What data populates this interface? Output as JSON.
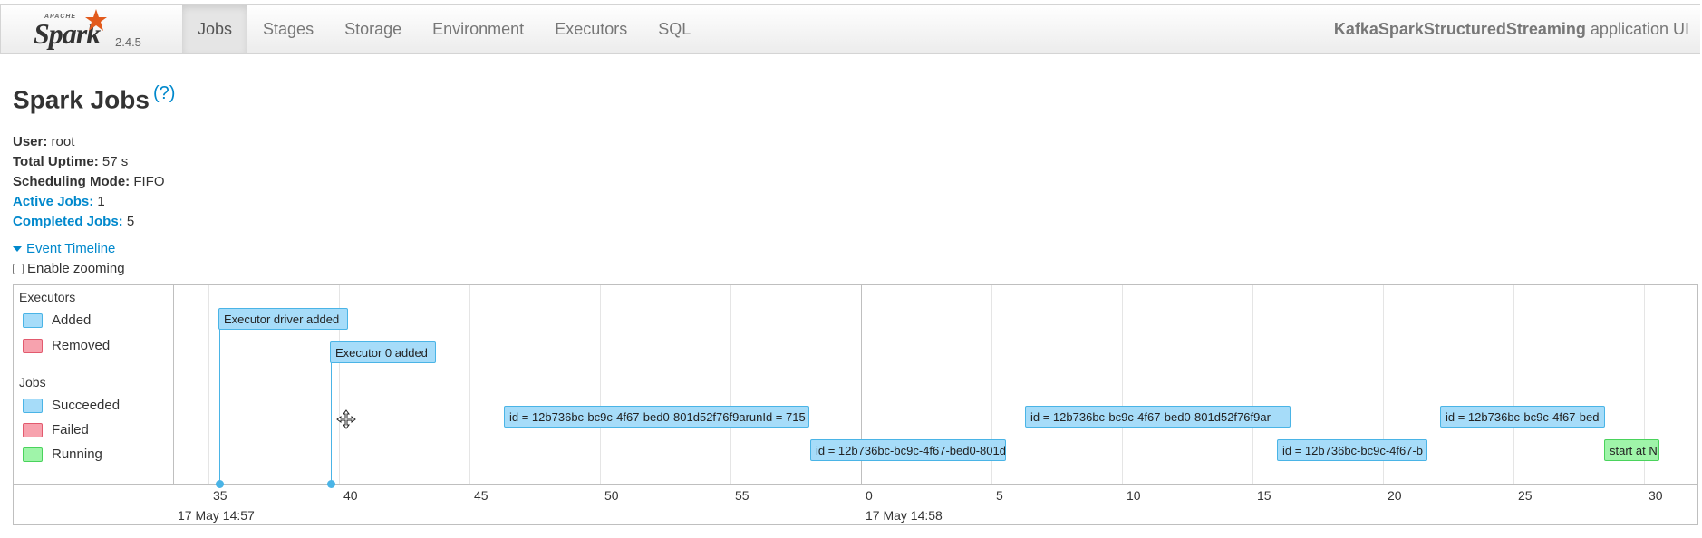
{
  "navbar": {
    "brand_apache": "APACHE",
    "brand_spark": "Spark",
    "version": "2.4.5",
    "tabs": [
      {
        "label": "Jobs",
        "active": true
      },
      {
        "label": "Stages",
        "active": false
      },
      {
        "label": "Storage",
        "active": false
      },
      {
        "label": "Environment",
        "active": false
      },
      {
        "label": "Executors",
        "active": false
      },
      {
        "label": "SQL",
        "active": false
      }
    ],
    "app_name": "KafkaSparkStructuredStreaming",
    "app_suffix": " application UI"
  },
  "page": {
    "title": "Spark Jobs",
    "help": "(?)"
  },
  "summary": {
    "user_label": "User:",
    "user_value": " root",
    "uptime_label": "Total Uptime:",
    "uptime_value": " 57 s",
    "mode_label": "Scheduling Mode:",
    "mode_value": " FIFO",
    "active_label": "Active Jobs:",
    "active_value": " 1",
    "completed_label": "Completed Jobs:",
    "completed_value": " 5"
  },
  "timeline": {
    "toggle_label": "Event Timeline",
    "zoom_label": "Enable zooming",
    "executors_group": "Executors",
    "jobs_group": "Jobs",
    "legend": {
      "added": "Added",
      "removed": "Removed",
      "succeeded": "Succeeded",
      "failed": "Failed",
      "running": "Running"
    },
    "ticks": [
      "35",
      "40",
      "45",
      "50",
      "55",
      "0",
      "5",
      "10",
      "15",
      "20",
      "25",
      "30"
    ],
    "date_labels": [
      "17 May 14:57",
      "17 May 14:58"
    ],
    "executor_events": [
      "Executor driver added",
      "Executor 0 added"
    ],
    "job_events": [
      "id = 12b736bc-bc9c-4f67-bed0-801d52f76f9arunId = 715",
      "id = 12b736bc-bc9c-4f67-bed0-801d",
      "id = 12b736bc-bc9c-4f67-bed0-801d52f76f9ar",
      "id = 12b736bc-bc9c-4f67-b",
      "id = 12b736bc-bc9c-4f67-bed",
      "start at N"
    ]
  },
  "colors": {
    "added": "#a6dcf9",
    "removed": "#f7a2ae",
    "succeeded": "#a6dcf9",
    "failed": "#f7a2ae",
    "running": "#9ff4a9",
    "link": "#0088cc"
  }
}
